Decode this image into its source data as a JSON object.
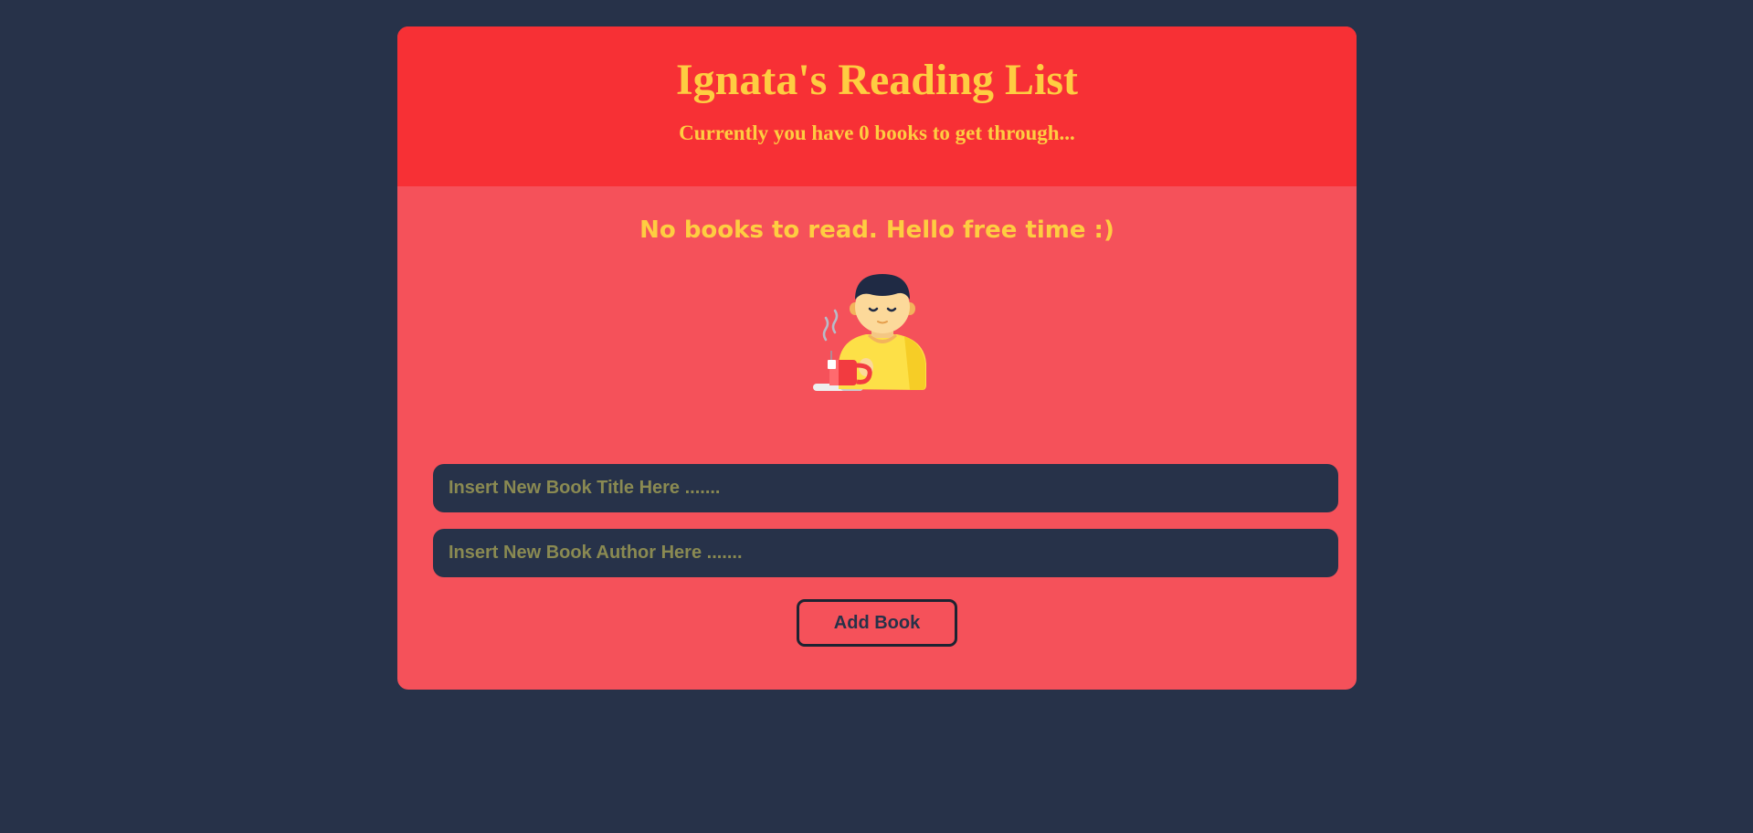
{
  "header": {
    "title": "Ignata's Reading List",
    "subtitle": "Currently you have 0 books to get through..."
  },
  "main": {
    "empty_message": "No books to read. Hello free time :)",
    "illustration_icon": "person-with-coffee-icon"
  },
  "form": {
    "title_placeholder": "Insert New Book Title Here .......",
    "title_value": "",
    "author_placeholder": "Insert New Book Author Here .......",
    "author_value": "",
    "add_button_label": "Add Book"
  },
  "colors": {
    "page_background": "#273249",
    "header_background": "#f73035",
    "card_background": "#f5515a",
    "accent_text": "#fecd41"
  }
}
